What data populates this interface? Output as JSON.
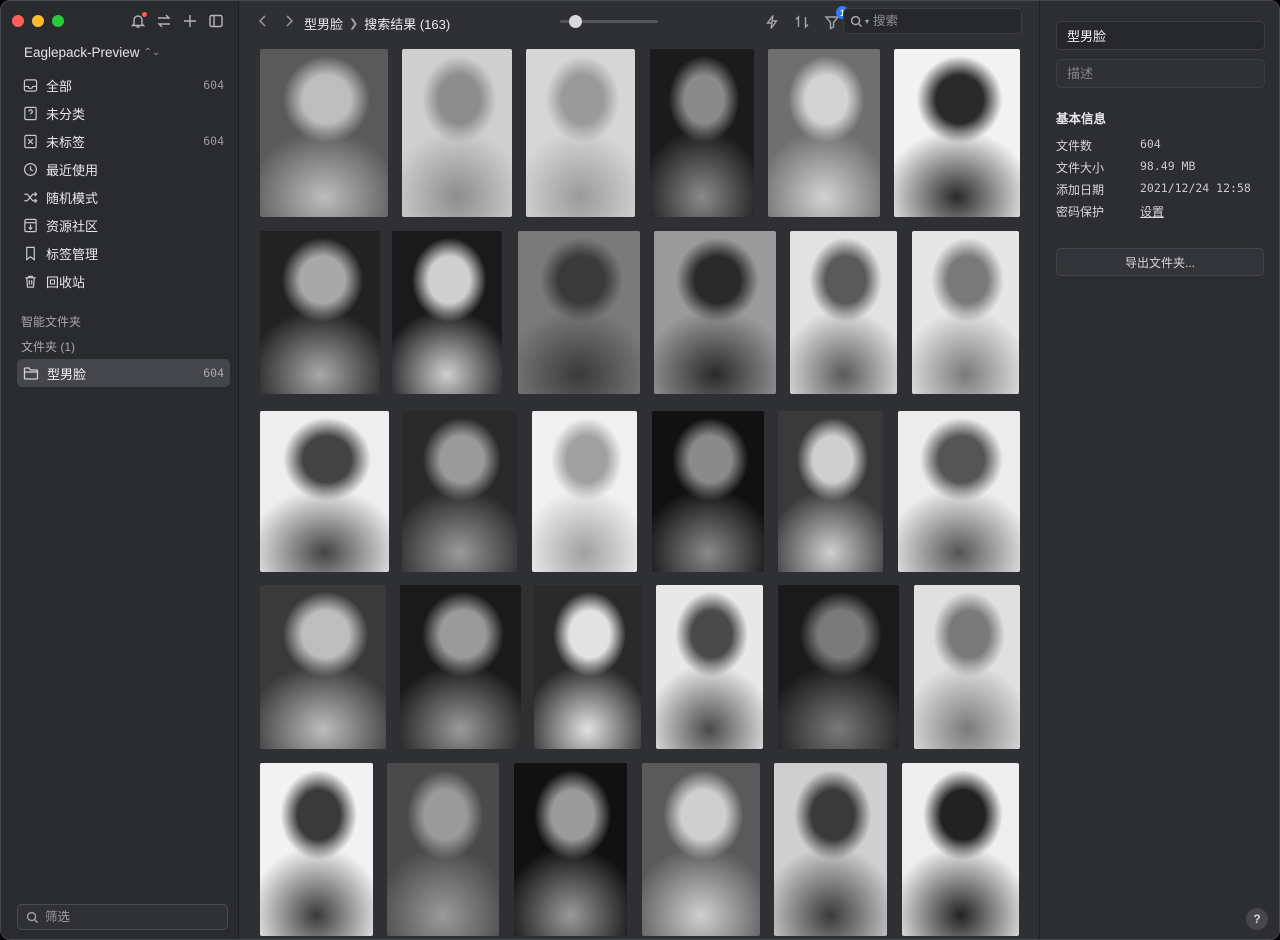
{
  "sidebar": {
    "library_name": "Eaglepack-Preview",
    "items": [
      {
        "label": "全部",
        "count": "604",
        "icon": "inbox-icon"
      },
      {
        "label": "未分类",
        "count": "",
        "icon": "unsorted-icon"
      },
      {
        "label": "未标签",
        "count": "604",
        "icon": "untagged-icon"
      },
      {
        "label": "最近使用",
        "count": "",
        "icon": "clock-icon"
      },
      {
        "label": "随机模式",
        "count": "",
        "icon": "shuffle-icon"
      },
      {
        "label": "资源社区",
        "count": "",
        "icon": "download-box-icon"
      },
      {
        "label": "标签管理",
        "count": "",
        "icon": "bookmark-icon"
      },
      {
        "label": "回收站",
        "count": "",
        "icon": "trash-icon"
      }
    ],
    "smart_folders_title": "智能文件夹",
    "folders_title": "文件夹 (1)",
    "folder": {
      "label": "型男脸",
      "count": "604"
    },
    "filter_placeholder": "筛选"
  },
  "toolbar": {
    "breadcrumb_folder": "型男脸",
    "breadcrumb_current": "搜索结果 (163)",
    "filter_badge": "1",
    "search_placeholder": "搜索",
    "zoom_level": 0.15
  },
  "inspector": {
    "name": "型男脸",
    "description_placeholder": "描述",
    "info_title": "基本信息",
    "rows": [
      {
        "key": "文件数",
        "value": "604"
      },
      {
        "key": "文件大小",
        "value": "98.49 MB"
      },
      {
        "key": "添加日期",
        "value": "2021/12/24 12:58"
      },
      {
        "key": "密码保护",
        "value": "设置"
      }
    ],
    "export_label": "导出文件夹...",
    "help_label": "?"
  }
}
